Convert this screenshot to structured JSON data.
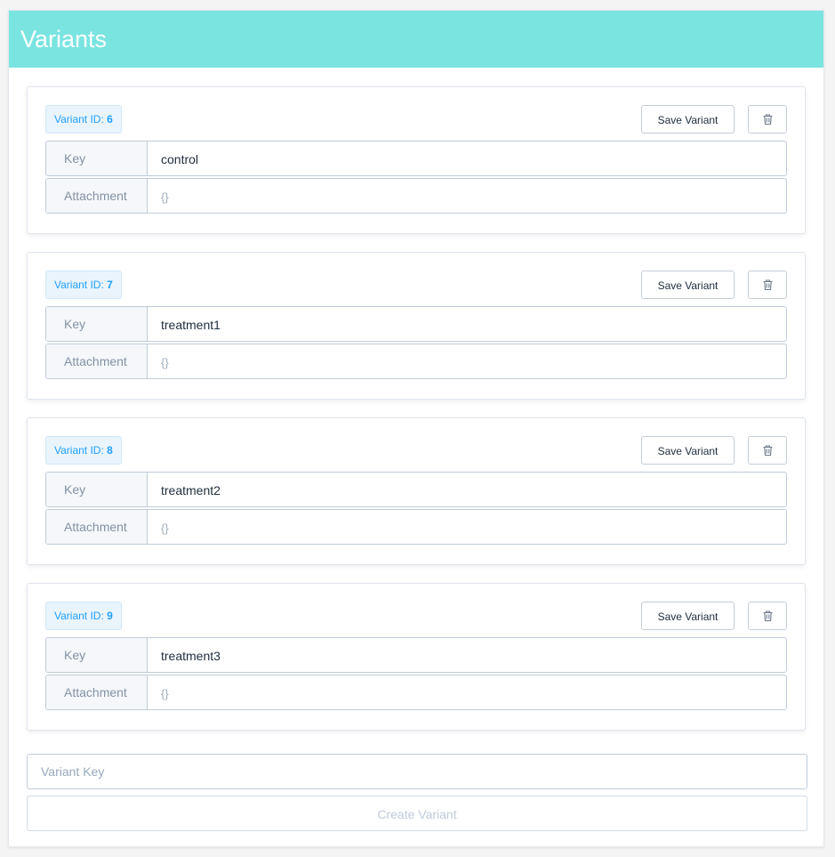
{
  "header": {
    "title": "Variants"
  },
  "variants": [
    {
      "id_label": "Variant ID:",
      "id": "6",
      "key_label": "Key",
      "key": "control",
      "attachment_label": "Attachment",
      "attachment": "{}",
      "save_label": "Save Variant",
      "delete_icon": "trash-icon"
    },
    {
      "id_label": "Variant ID:",
      "id": "7",
      "key_label": "Key",
      "key": "treatment1",
      "attachment_label": "Attachment",
      "attachment": "{}",
      "save_label": "Save Variant",
      "delete_icon": "trash-icon"
    },
    {
      "id_label": "Variant ID:",
      "id": "8",
      "key_label": "Key",
      "key": "treatment2",
      "attachment_label": "Attachment",
      "attachment": "{}",
      "save_label": "Save Variant",
      "delete_icon": "trash-icon"
    },
    {
      "id_label": "Variant ID:",
      "id": "9",
      "key_label": "Key",
      "key": "treatment3",
      "attachment_label": "Attachment",
      "attachment": "{}",
      "save_label": "Save Variant",
      "delete_icon": "trash-icon"
    }
  ],
  "new_variant": {
    "placeholder": "Variant Key",
    "value": "",
    "create_label": "Create Variant"
  },
  "colors": {
    "header_bg": "#7ae4e1",
    "tag_text": "#20a0ff",
    "tag_bg": "#eaf4fd"
  }
}
